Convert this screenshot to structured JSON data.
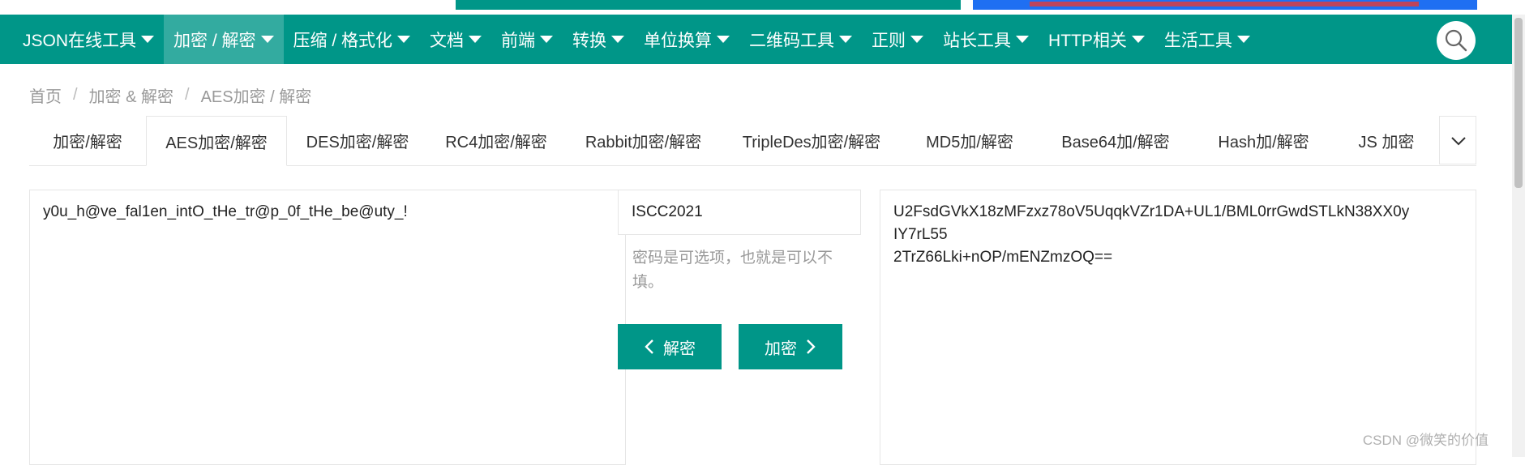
{
  "colors": {
    "brand": "#009688",
    "brand_active": "#33aba0",
    "banner_blue": "#1f6ff2",
    "banner_red": "#e53935"
  },
  "nav": {
    "items": [
      {
        "label": "JSON在线工具"
      },
      {
        "label": "加密 / 解密"
      },
      {
        "label": "压缩 / 格式化"
      },
      {
        "label": "文档"
      },
      {
        "label": "前端"
      },
      {
        "label": "转换"
      },
      {
        "label": "单位换算"
      },
      {
        "label": "二维码工具"
      },
      {
        "label": "正则"
      },
      {
        "label": "站长工具"
      },
      {
        "label": "HTTP相关"
      },
      {
        "label": "生活工具"
      }
    ],
    "search_icon": "search-icon"
  },
  "breadcrumb": {
    "items": [
      "首页",
      "加密 & 解密",
      "AES加密 / 解密"
    ],
    "separator": "/"
  },
  "tabs": {
    "items": [
      {
        "label": "加密/解密"
      },
      {
        "label": "AES加密/解密"
      },
      {
        "label": "DES加密/解密"
      },
      {
        "label": "RC4加密/解密"
      },
      {
        "label": "Rabbit加密/解密"
      },
      {
        "label": "TripleDes加密/解密"
      },
      {
        "label": "MD5加/解密"
      },
      {
        "label": "Base64加/解密"
      },
      {
        "label": "Hash加/解密"
      },
      {
        "label": "JS 加密"
      }
    ],
    "active": "AES加密/解密",
    "more_icon": "chevron-down-icon"
  },
  "plaintext": {
    "value": "y0u_h@ve_fal1en_intO_tHe_tr@p_0f_tHe_be@uty_!"
  },
  "key": {
    "value": "ISCC2021",
    "hint": "密码是可选项，也就是可以不填。"
  },
  "buttons": {
    "decrypt": "解密",
    "encrypt": "加密"
  },
  "ciphertext": {
    "lines": [
      "U2FsdGVkX18zMFzxz78oV5UqqkVZr1DA+UL1/BML0rrGwdSTLkN38XX0y",
      "IY7rL55",
      "2TrZ66Lki+nOP/mENZmzOQ=="
    ]
  },
  "watermark": "CSDN @微笑的价值"
}
